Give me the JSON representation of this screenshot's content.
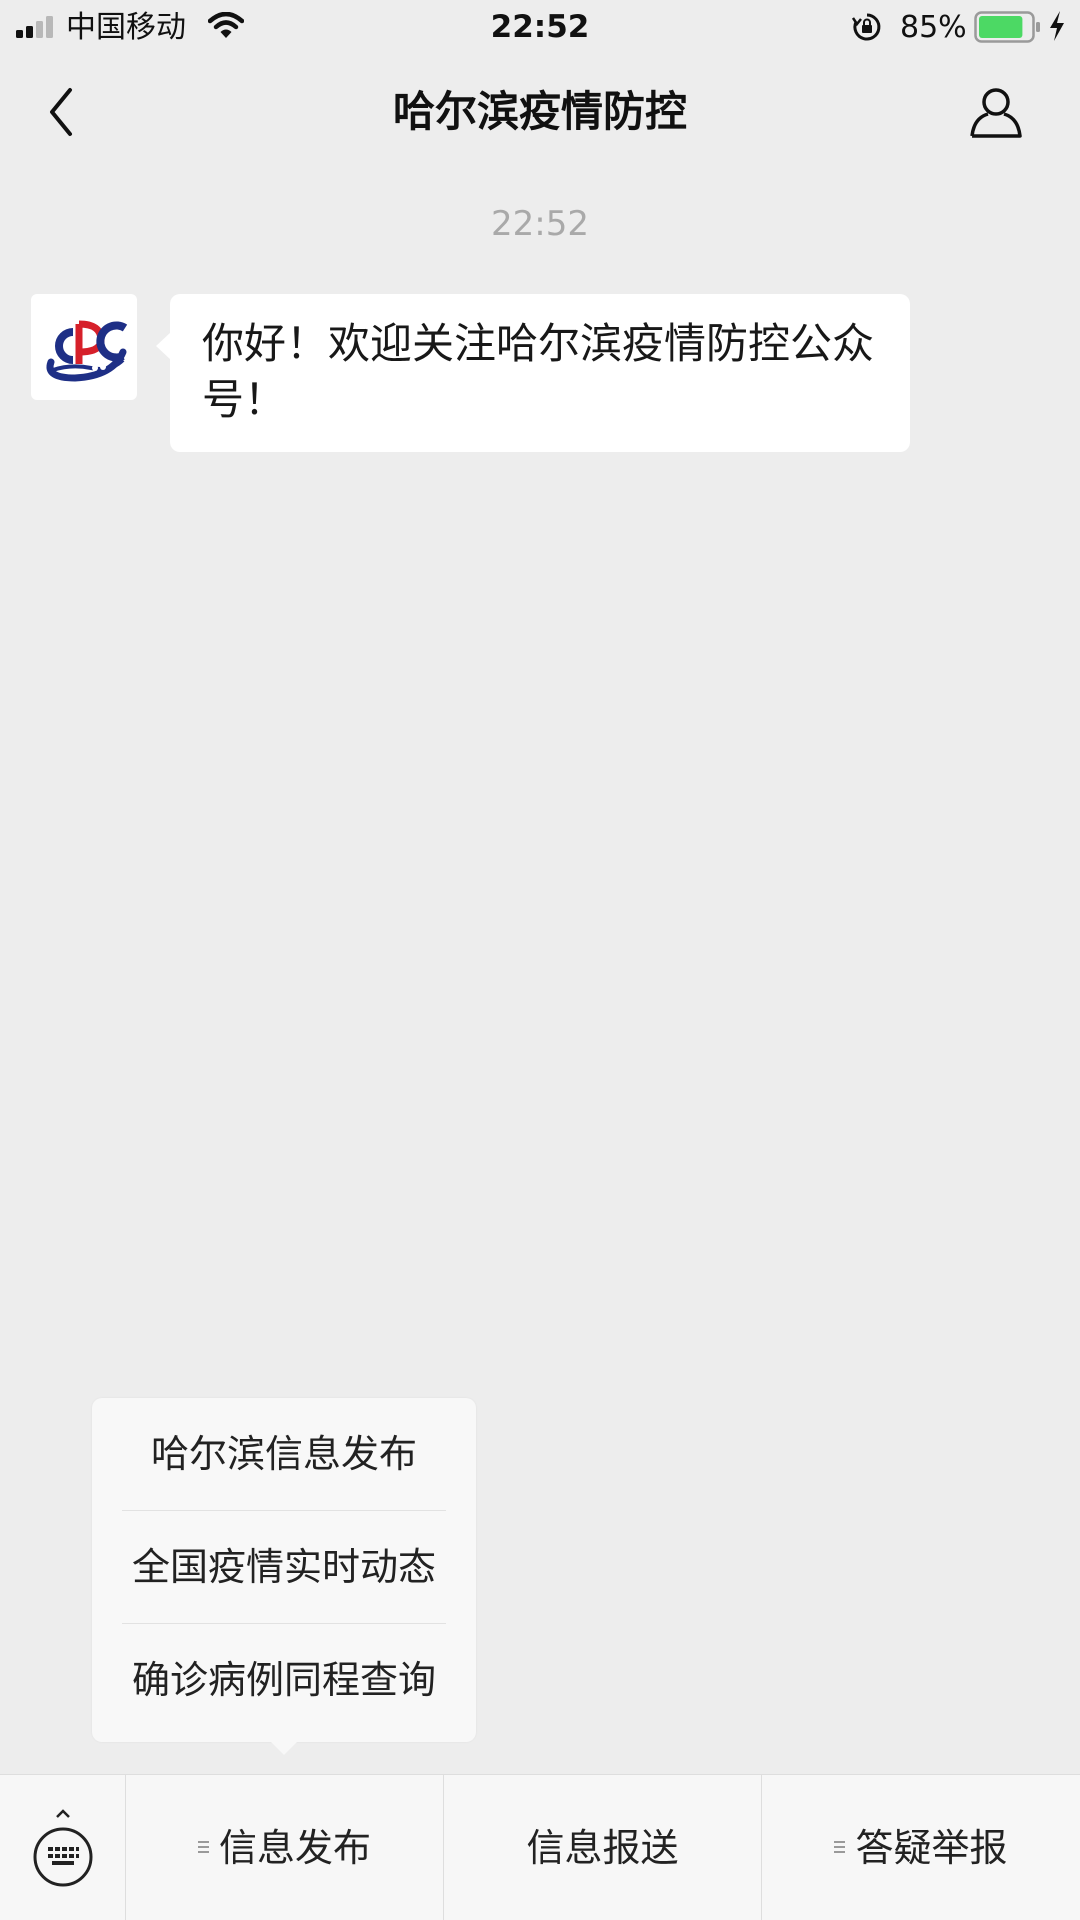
{
  "status_bar": {
    "carrier": "中国移动",
    "time": "22:52",
    "battery_percent": "85%",
    "battery_level": 0.85,
    "signal_bars_active": 2,
    "signal_bars_total": 4
  },
  "nav": {
    "title": "哈尔滨疫情防控",
    "back_icon": "chevron-left-icon",
    "profile_icon": "person-icon"
  },
  "chat": {
    "timestamp": "22:52",
    "messages": [
      {
        "sender_avatar": "cdc-logo",
        "text": "你好！欢迎关注哈尔滨疫情防控公众号！"
      }
    ]
  },
  "popup_menu": {
    "items": [
      {
        "label": "哈尔滨信息发布"
      },
      {
        "label": "全国疫情实时动态"
      },
      {
        "label": "确诊病例同程查询"
      }
    ]
  },
  "menu_bar": {
    "keyboard_icon": "keyboard-icon",
    "buttons": [
      {
        "label": "信息发布",
        "has_submenu": true
      },
      {
        "label": "信息报送",
        "has_submenu": false
      },
      {
        "label": "答疑举报",
        "has_submenu": true
      }
    ]
  },
  "colors": {
    "background": "#ededed",
    "bubble": "#ffffff",
    "battery_fill": "#4cd964",
    "logo_red": "#d6202a",
    "logo_blue": "#1e2f86"
  }
}
